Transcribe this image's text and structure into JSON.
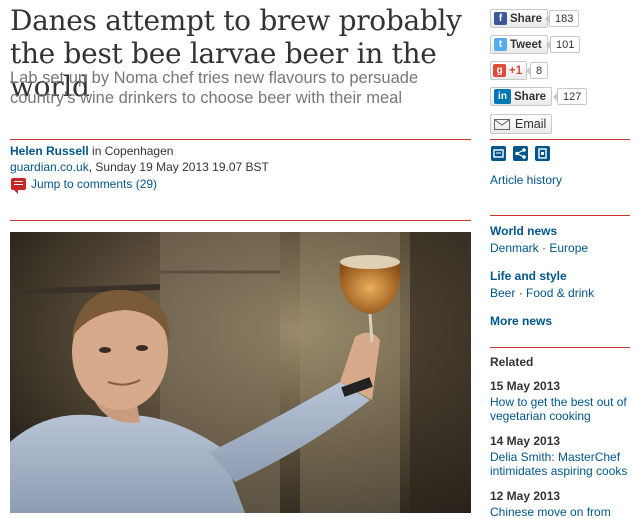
{
  "article": {
    "headline": "Danes attempt to brew probably the best bee larvae beer in the world",
    "standfirst": "Lab set up by Noma chef tries new flavours to persuade country's wine drinkers to choose beer with their meal",
    "author": "Helen Russell",
    "location": "in Copenhagen",
    "site": "guardian.co.uk",
    "date": ", Sunday 19 May 2013 19.07 BST",
    "comments_link": "Jump to comments (29)"
  },
  "share": {
    "facebook_label": "Share",
    "facebook_count": "183",
    "twitter_label": "Tweet",
    "twitter_count": "101",
    "gplus_label": "+1",
    "gplus_count": "8",
    "linkedin_label": "Share",
    "linkedin_count": "127",
    "email_label": "Email"
  },
  "sidebar": {
    "article_history": "Article history",
    "world_news": "World news",
    "world_sub_1": "Denmark",
    "world_sub_2": "Europe",
    "life_style": "Life and style",
    "life_sub_1": "Beer",
    "life_sub_2": "Food & drink",
    "more_news": "More news",
    "separator": " · "
  },
  "related": {
    "heading": "Related",
    "items": [
      {
        "date": "15 May 2013",
        "title": "How to get the best out of vegetarian cooking"
      },
      {
        "date": "14 May 2013",
        "title": "Delia Smith: MasterChef intimidates aspiring cooks"
      },
      {
        "date": "12 May 2013",
        "title": "Chinese move on from"
      }
    ]
  },
  "colors": {
    "rule": "#c0392b",
    "link": "#005689",
    "facebook": "#3b5998",
    "twitter": "#55acee",
    "gplus": "#dd4b39",
    "linkedin": "#0077b5"
  }
}
